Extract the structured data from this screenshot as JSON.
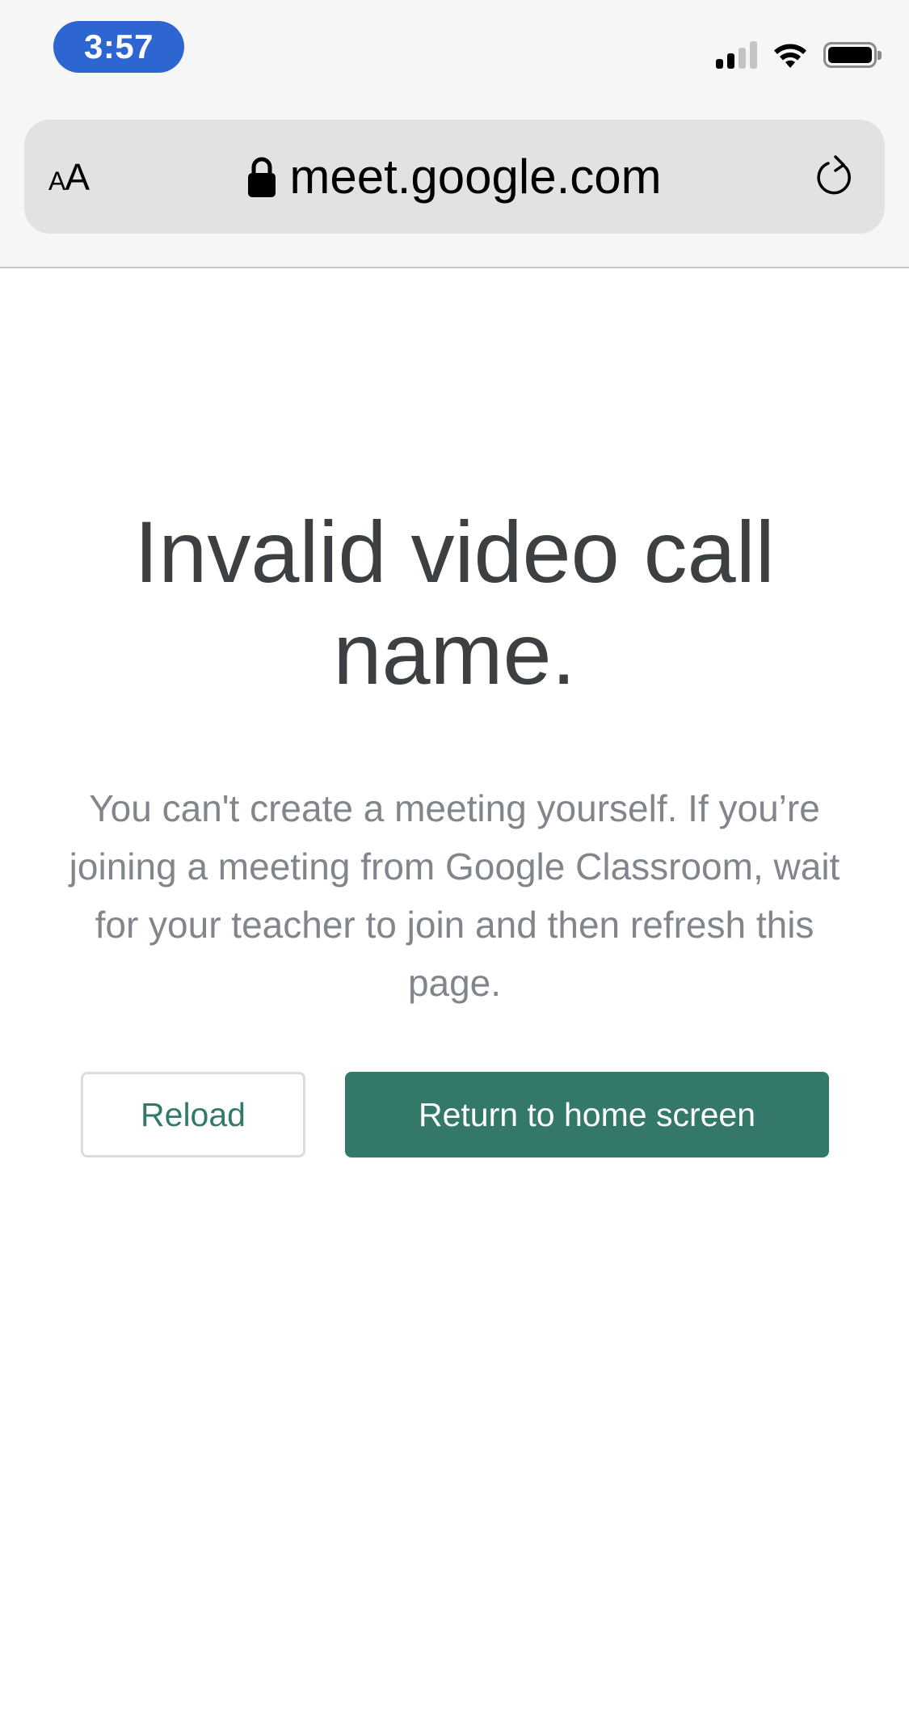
{
  "status_bar": {
    "time": "3:57",
    "icons": [
      "cellular-signal-icon",
      "wifi-icon",
      "battery-icon"
    ],
    "signal_bars_active": 2,
    "signal_bars_total": 4
  },
  "browser": {
    "text_size_label_small": "A",
    "text_size_label_large": "A",
    "url": "meet.google.com",
    "icons": [
      "lock-icon",
      "reload-icon"
    ]
  },
  "page": {
    "title": "Invalid video call name.",
    "message": "You can't create a meeting yourself. If you’re joining a meeting from Google Classroom, wait for your teacher to join and then refresh this page.",
    "buttons": {
      "reload": "Reload",
      "return_home": "Return to home screen"
    }
  },
  "colors": {
    "time_pill": "#2e66d1",
    "primary_button": "#34786a",
    "secondary_button_text": "#33796a",
    "title_text": "#3c4043",
    "body_text": "#80868b"
  }
}
